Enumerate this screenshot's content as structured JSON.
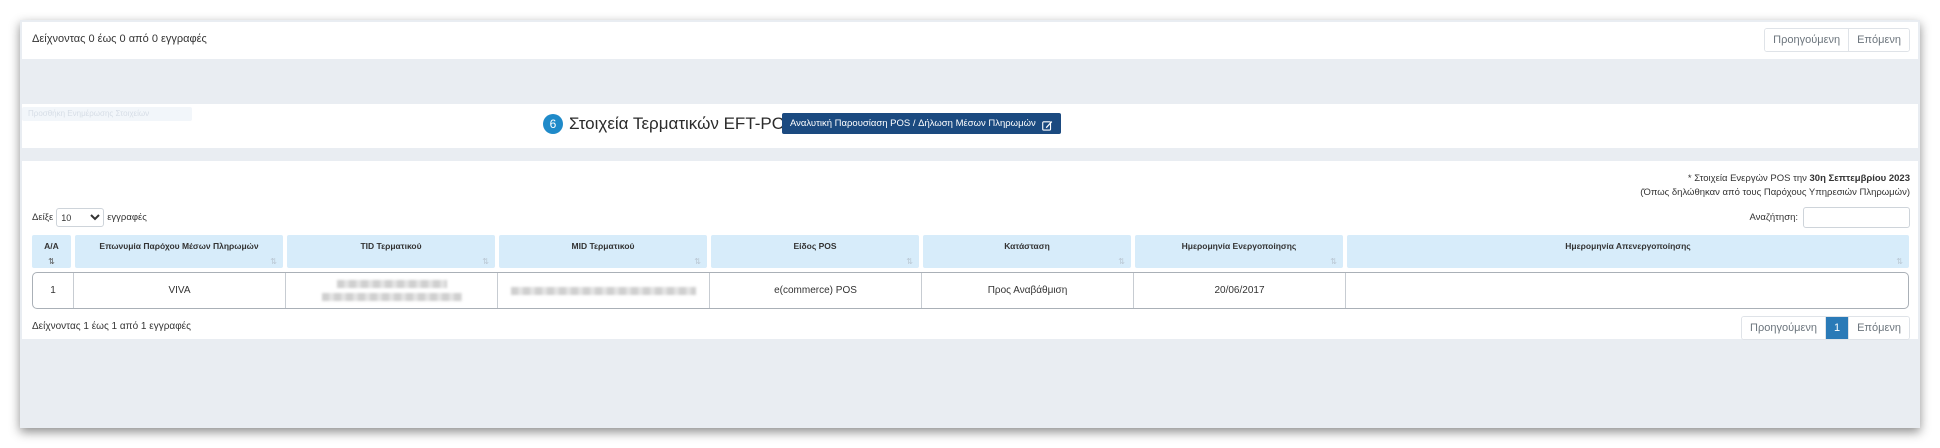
{
  "top_panel": {
    "info": "Δείχνοντας 0 έως 0 από 0 εγγραφές",
    "prev": "Προηγούμενη",
    "next": "Επόμενη"
  },
  "faded_button": "Προσθήκη Ενημέρωσης Στοιχείων",
  "section": {
    "number": "6",
    "title": "Στοιχεία Τερματικών EFT-POS",
    "button": "Αναλυτική Παρουσίαση POS / Δήλωση Μέσων Πληρωμών",
    "button_icon": "edit-icon"
  },
  "note": {
    "prefix": "* Στοιχεία Ενεργών POS την",
    "date": "30η Σεπτεμβρίου 2023",
    "line2": "(Όπως δηλώθηκαν από τους Παρόχους Υπηρεσιών Πληρωμών)"
  },
  "length_menu": {
    "show": "Δείξε",
    "value": "10",
    "options": [
      "10"
    ],
    "suffix": "εγγραφές"
  },
  "search": {
    "label": "Αναζήτηση:"
  },
  "table": {
    "headers": [
      "Α/Α",
      "Επωνυμία Παρόχου Μέσων Πληρωμών",
      "TID Τερματικού",
      "MID Τερματικού",
      "Είδος POS",
      "Κατάσταση",
      "Ημερομηνία Ενεργοποίησης",
      "Ημερομηνία Απενεργοποίησης"
    ],
    "rows": [
      {
        "aa": "1",
        "provider": "VIVA",
        "tid": "",
        "mid": "",
        "pos_type": "e(commerce) POS",
        "status": "Προς Αναβάθμιση",
        "activation": "20/06/2017",
        "deactivation": ""
      }
    ]
  },
  "bottom": {
    "info": "Δείχνοντας 1 έως 1 από 1 εγγραφές",
    "prev": "Προηγούμενη",
    "page": "1",
    "next": "Επόμενη"
  },
  "colors": {
    "accent": "#1b4a80",
    "badge": "#1f8ac9",
    "header_bg": "#d7ecfa",
    "page_active": "#2a7ab7",
    "frame_bg": "#e9edf2"
  }
}
